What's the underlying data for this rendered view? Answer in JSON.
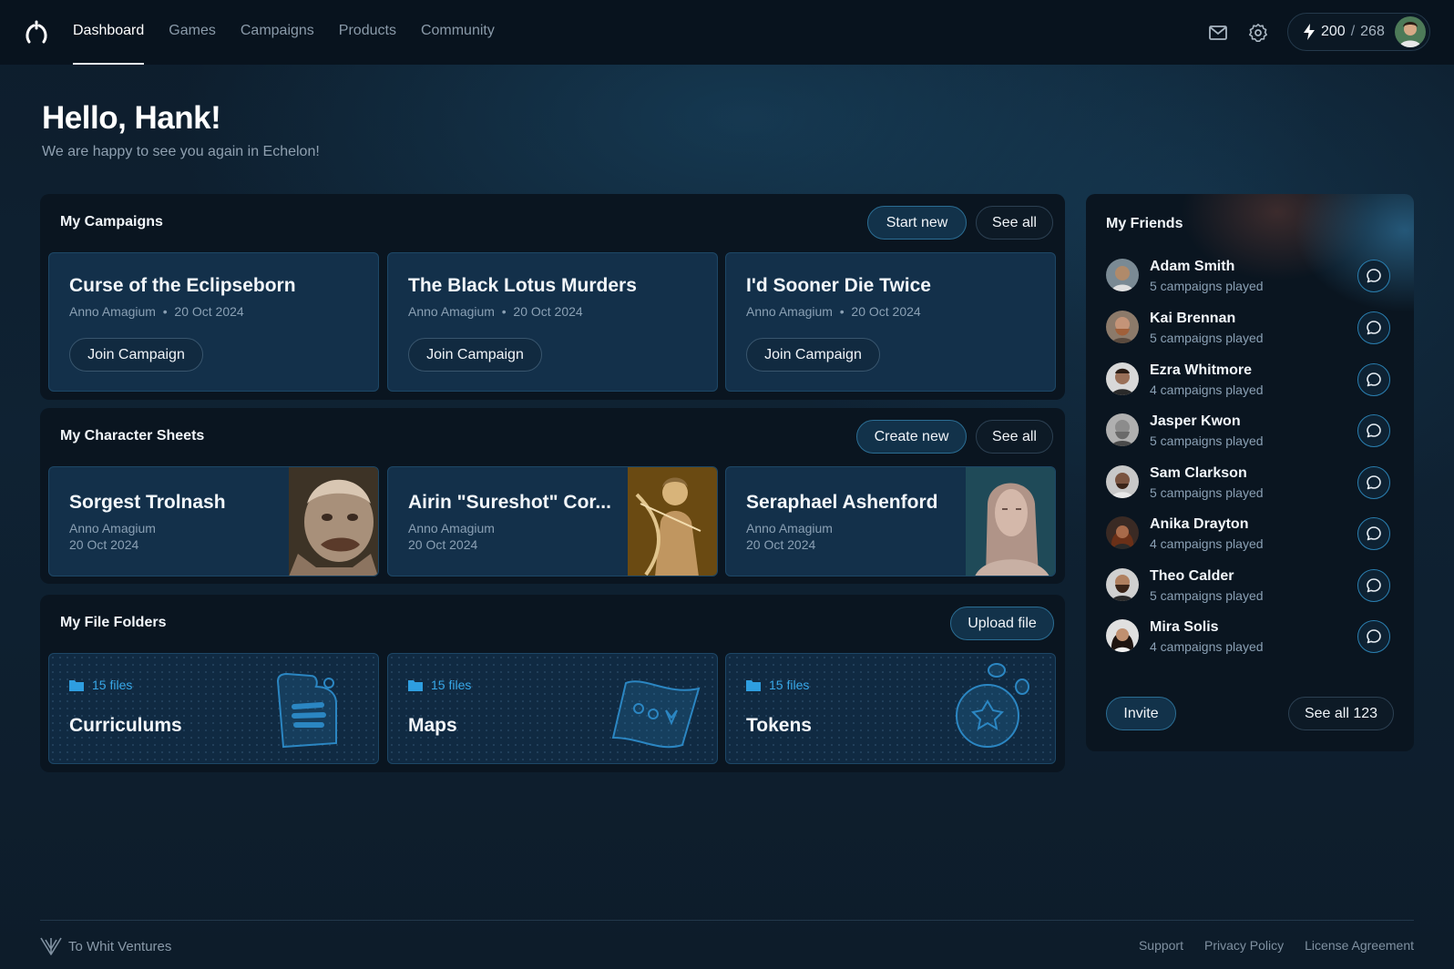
{
  "nav": {
    "items": [
      {
        "label": "Dashboard",
        "active": true
      },
      {
        "label": "Games",
        "active": false
      },
      {
        "label": "Campaigns",
        "active": false
      },
      {
        "label": "Products",
        "active": false
      },
      {
        "label": "Community",
        "active": false
      }
    ]
  },
  "header": {
    "points_current": "200",
    "points_sep": "/",
    "points_max": "268",
    "icons": [
      "mail-icon",
      "settings-gear-icon",
      "lightning-bolt-icon"
    ]
  },
  "greeting": {
    "title": "Hello, Hank!",
    "subtitle": "We are happy to see you again in Echelon!"
  },
  "campaigns": {
    "title": "My Campaigns",
    "start_new": "Start new",
    "see_all": "See all",
    "items": [
      {
        "title": "Curse of the Eclipseborn",
        "author": "Anno Amagium",
        "bullet": "•",
        "date": "20 Oct 2024",
        "action": "Join Campaign"
      },
      {
        "title": "The Black Lotus Murders",
        "author": "Anno Amagium",
        "bullet": "•",
        "date": "20 Oct 2024",
        "action": "Join Campaign"
      },
      {
        "title": "I'd Sooner Die Twice",
        "author": "Anno Amagium",
        "bullet": "•",
        "date": "20 Oct 2024",
        "action": "Join Campaign"
      }
    ]
  },
  "characters": {
    "title": "My Character Sheets",
    "create_new": "Create new",
    "see_all": "See all",
    "items": [
      {
        "name": "Sorgest Trolnash",
        "author": "Anno Amagium",
        "date": "20 Oct 2024"
      },
      {
        "name": "Airin \"Sureshot\" Cor...",
        "author": "Anno Amagium",
        "date": "20 Oct 2024"
      },
      {
        "name": "Seraphael Ashenford",
        "author": "Anno Amagium",
        "date": "20 Oct 2024"
      }
    ]
  },
  "folders": {
    "title": "My File Folders",
    "upload": "Upload file",
    "items": [
      {
        "count": "15 files",
        "name": "Curriculums",
        "icon": "document-icon"
      },
      {
        "count": "15 files",
        "name": "Maps",
        "icon": "map-icon"
      },
      {
        "count": "15 files",
        "name": "Tokens",
        "icon": "token-icon"
      }
    ]
  },
  "friends": {
    "title": "My Friends",
    "invite": "Invite",
    "see_all": "See all 123",
    "items": [
      {
        "name": "Adam Smith",
        "played": "5 campaigns played",
        "color": "#b08a6a"
      },
      {
        "name": "Kai Brennan",
        "played": "5 campaigns played",
        "color": "#c49478"
      },
      {
        "name": "Ezra Whitmore",
        "played": "4 campaigns played",
        "color": "#9a7058"
      },
      {
        "name": "Jasper Kwon",
        "played": "5 campaigns played",
        "color": "#8c8c8c"
      },
      {
        "name": "Sam Clarkson",
        "played": "5 campaigns played",
        "color": "#7a5440"
      },
      {
        "name": "Anika Drayton",
        "played": "4 campaigns played",
        "color": "#a86a4a"
      },
      {
        "name": "Theo Calder",
        "played": "5 campaigns played",
        "color": "#6e4a3a"
      },
      {
        "name": "Mira Solis",
        "played": "4 campaigns played",
        "color": "#5a3a2e"
      }
    ]
  },
  "footer": {
    "brand": "To Whit Ventures",
    "links": [
      "Support",
      "Privacy Policy",
      "License Agreement"
    ]
  },
  "colors": {
    "accent": "#2b8fd0",
    "background": "#0f2233",
    "panel": "#0a1520",
    "card": "#13304a"
  }
}
